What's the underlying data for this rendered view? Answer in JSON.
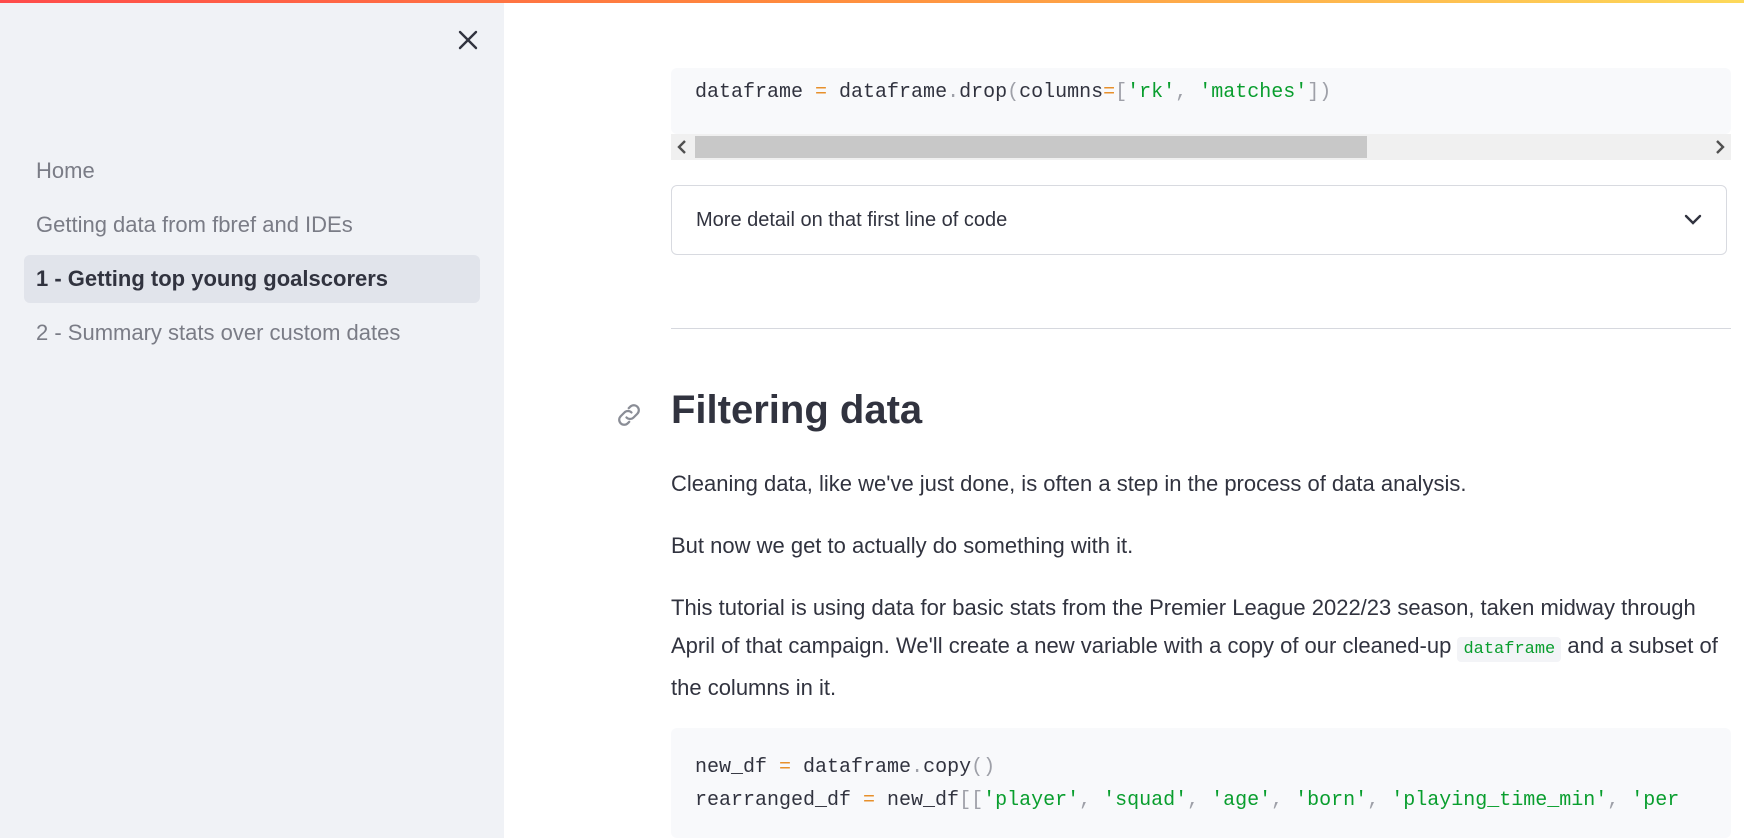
{
  "sidebar": {
    "items": [
      {
        "label": "Home"
      },
      {
        "label": "Getting data from fbref and IDEs"
      },
      {
        "label": "1 - Getting top young goalscorers"
      },
      {
        "label": "2 - Summary stats over custom dates"
      }
    ],
    "close_icon": "close-x-icon"
  },
  "main": {
    "code1": {
      "t1": "dataframe",
      "t2": " = ",
      "t3": "dataframe",
      "t4": ".",
      "t5": "drop",
      "t6": "(",
      "t7": "columns",
      "t8": "=",
      "t9": "[",
      "t10": "'rk'",
      "t11": ", ",
      "t12": "'matches'",
      "t13": "])"
    },
    "expander": {
      "label": "More detail on that first line of code"
    },
    "heading": "Filtering data",
    "para1": "Cleaning data, like we've just done, is often a step in the process of data analysis.",
    "para2": "But now we get to actually do something with it.",
    "para3": {
      "before": "This tutorial is using data for basic stats from the Premier League 2022/23 season, taken midway through April of that campaign. We'll create a new variable with a copy of our cleaned-up ",
      "code": "dataframe",
      "after": " and a subset of the columns in it."
    },
    "code2": {
      "l1": {
        "a": "new_df",
        "b": " = ",
        "c": "dataframe",
        "d": ".",
        "e": "copy",
        "f": "()"
      },
      "l2": {
        "a": "rearranged_df",
        "b": " = ",
        "c": "new_df",
        "d": "[[",
        "s1": "'player'",
        "c1": ", ",
        "s2": "'squad'",
        "c2": ", ",
        "s3": "'age'",
        "c3": ", ",
        "s4": "'born'",
        "c4": ", ",
        "s5": "'playing_time_min'",
        "c5": ", ",
        "s6": "'per"
      }
    }
  },
  "colors": {
    "accent_gradient_start": "#ff4b4b",
    "accent_gradient_end": "#fdd95a",
    "string": "#099e2e",
    "operator": "#e7902b"
  }
}
